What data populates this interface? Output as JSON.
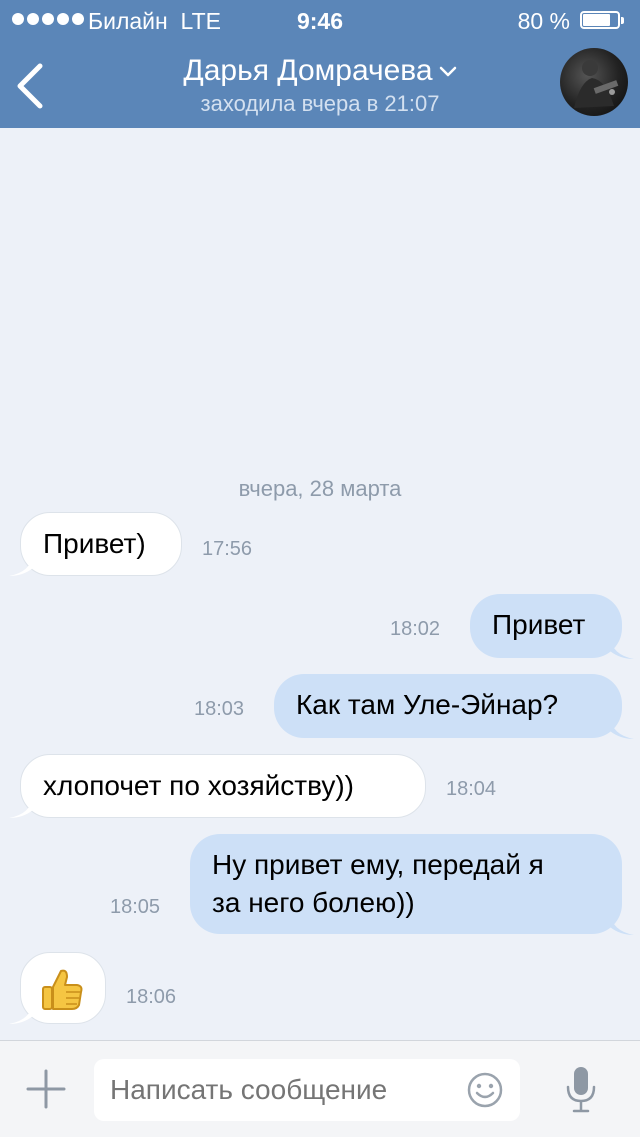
{
  "status_bar": {
    "carrier": "Билайн",
    "network": "LTE",
    "time": "9:46",
    "battery": "80 %",
    "battery_level": 0.8
  },
  "header": {
    "name": "Дарья Домрачева",
    "last_seen": "заходила вчера в 21:07",
    "icons": [
      "back-arrow-icon",
      "chevron-down-icon",
      "avatar"
    ]
  },
  "chat": {
    "date_separator": "вчера, 28 марта",
    "messages": [
      {
        "direction": "in",
        "lines": [
          "Привет)"
        ],
        "time": "17:56"
      },
      {
        "direction": "out",
        "lines": [
          "Привет"
        ],
        "time": "18:02"
      },
      {
        "direction": "out",
        "lines": [
          "Как там Уле-Эйнар?"
        ],
        "time": "18:03"
      },
      {
        "direction": "in",
        "lines": [
          "хлопочет по хозяйству))"
        ],
        "time": "18:04"
      },
      {
        "direction": "out",
        "lines": [
          "Ну привет ему, передай я",
          "за него болею))"
        ],
        "time": "18:05"
      },
      {
        "direction": "in",
        "lines": [
          "👍"
        ],
        "emoji": "thumbs-up",
        "time": "18:06"
      }
    ]
  },
  "composer": {
    "placeholder": "Написать сообщение",
    "icons": [
      "plus-icon",
      "smiley-icon",
      "microphone-icon"
    ]
  },
  "colors": {
    "header": "#5b86b8",
    "background": "#edf1f8",
    "incoming_bubble": "#ffffff",
    "outgoing_bubble": "#cde0f7",
    "timestamp": "#8e9bab"
  }
}
